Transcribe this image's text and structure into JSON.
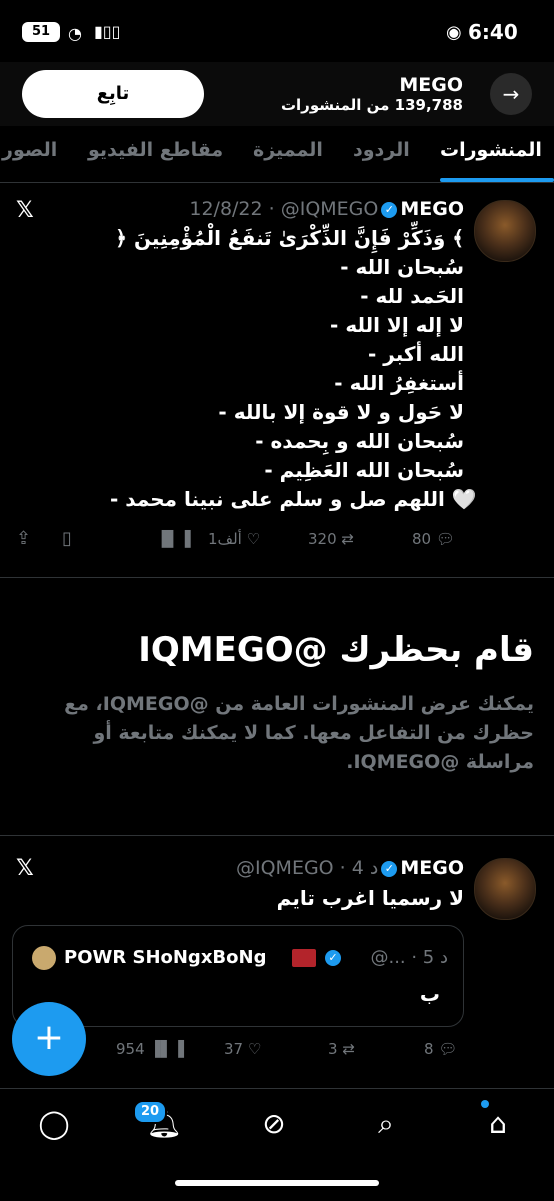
{
  "status_bar": {
    "time": "6:40",
    "battery": "51"
  },
  "header": {
    "name": "MEGO",
    "posts_count": "139,788 من المنشورات",
    "follow_label": "تابِع",
    "back_icon": "arrow-right-icon"
  },
  "tabs": [
    {
      "label": "المنشورات",
      "active": true
    },
    {
      "label": "الردود"
    },
    {
      "label": "المميزة"
    },
    {
      "label": "مقاطع الفيديو"
    },
    {
      "label": "الصور"
    }
  ],
  "post1": {
    "name": "MEGO",
    "handle_date": "12/8/22 · @IQMEGO",
    "lines": [
      "﴿ وَذَكِّرْ فَإِنَّ الذِّكْرَىٰ تَنفَعُ الْمُؤْمِنِينَ ﴾",
      "- سُبحان الله",
      "- الحَمد لله",
      "- لا إله إلا الله",
      "- الله أكبر",
      "- أستغفِرُ الله",
      "- لا حَول و لا قوة إلا بالله",
      "- سُبحان الله و بِحمده",
      "- سُبحان الله العَظِيم",
      "- اللهم صل و سلم على نبينا محمد 🤍"
    ],
    "replies": "80",
    "reposts": "320",
    "likes": "1ألف"
  },
  "blocked": {
    "title": "قام بحظرك @IQMEGO",
    "body": "يمكنك عرض المنشورات العامة من @IQMEGO، مع حظرك من التفاعل معها. كما لا يمكنك متابعة أو مراسلة @IQMEGO."
  },
  "post2": {
    "name": "MEGO",
    "handle_date": "@IQMEGO · 4 د",
    "text": "لا رسميا اغرب تايم",
    "quote": {
      "name": "POWR SHoNgxBoNg",
      "meta": "@... · 5 د",
      "text": "ب"
    },
    "replies": "8",
    "reposts": "3",
    "likes": "37",
    "views": "954"
  },
  "bottom_nav": {
    "notifications_badge": "20"
  },
  "colors": {
    "accent": "#1d9bf0",
    "background": "#000000",
    "muted": "#71767b"
  }
}
